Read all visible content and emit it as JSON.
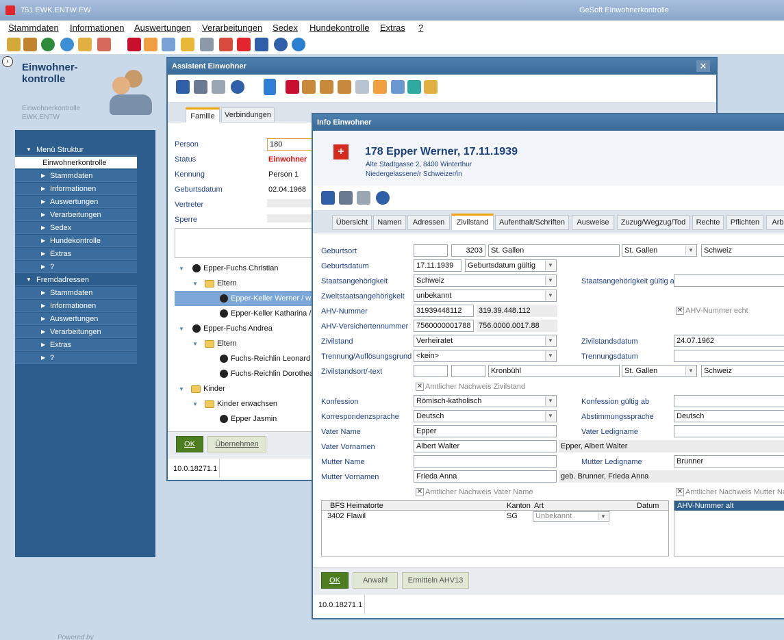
{
  "app": {
    "title": "751  EWK.ENTW  EW",
    "center_title": "GeSoft Einwohnerkontrolle"
  },
  "menu": [
    "Stammdaten",
    "Informationen",
    "Auswertungen",
    "Verarbeitungen",
    "Sedex",
    "Hundekontrolle",
    "Extras",
    "?"
  ],
  "left": {
    "title_line1": "Einwohner-",
    "title_line2": "kontrolle",
    "sub1": "Einwohnerkontrolle",
    "sub2": "EWK.ENTW",
    "powered": "Powered by",
    "nav": [
      {
        "label": "Menü Struktur",
        "kind": "sec",
        "arrow": "▼"
      },
      {
        "label": "Einwohnerkontrolle",
        "kind": "sel",
        "arrow": ""
      },
      {
        "label": "Stammdaten",
        "kind": "item",
        "arrow": "▶"
      },
      {
        "label": "Informationen",
        "kind": "item",
        "arrow": "▶"
      },
      {
        "label": "Auswertungen",
        "kind": "item",
        "arrow": "▶"
      },
      {
        "label": "Verarbeitungen",
        "kind": "item",
        "arrow": "▶"
      },
      {
        "label": "Sedex",
        "kind": "item",
        "arrow": "▶"
      },
      {
        "label": "Hundekontrolle",
        "kind": "item",
        "arrow": "▶"
      },
      {
        "label": "Extras",
        "kind": "item",
        "arrow": "▶"
      },
      {
        "label": "?",
        "kind": "item",
        "arrow": "▶"
      },
      {
        "label": "Fremdadressen",
        "kind": "sec",
        "arrow": "▼"
      },
      {
        "label": "Stammdaten",
        "kind": "item",
        "arrow": "▶"
      },
      {
        "label": "Informationen",
        "kind": "item",
        "arrow": "▶"
      },
      {
        "label": "Auswertungen",
        "kind": "item",
        "arrow": "▶"
      },
      {
        "label": "Verarbeitungen",
        "kind": "item",
        "arrow": "▶"
      },
      {
        "label": "Extras",
        "kind": "item",
        "arrow": "▶"
      },
      {
        "label": "?",
        "kind": "item",
        "arrow": "▶"
      }
    ]
  },
  "assist": {
    "title": "Assistent Einwohner",
    "tabs": [
      "Familie",
      "Verbindungen"
    ],
    "person_label": "Person",
    "person": "180",
    "status_label": "Status",
    "status": "Einwohner",
    "kennung_label": "Kennung",
    "kennung": "Person 1",
    "geb_label": "Geburtsdatum",
    "geb": "02.04.1968",
    "vertreter_label": "Vertreter",
    "sperre_label": "Sperre",
    "tree": [
      "Epper-Fuchs Christian",
      "Eltern",
      "Epper-Keller Werner / w",
      "Epper-Keller Katharina / v",
      "Epper-Fuchs Andrea",
      "Eltern",
      "Fuchs-Reichlin Leonard /",
      "Fuchs-Reichlin Dorothea",
      "Kinder",
      "Kinder erwachsen",
      "Epper Jasmin"
    ],
    "ok": "OK",
    "uebernehmen": "Übernehmen",
    "version": "10.0.18271.1"
  },
  "info": {
    "title": "Info Einwohner",
    "name": "178 Epper Werner, 17.11.1939",
    "addr": "Alte Stadtgasse 2, 8400 Winterthur",
    "status": "Niedergelassene/r Schweizer/in",
    "tabs": [
      "Übersicht",
      "Namen",
      "Adressen",
      "Zivilstand",
      "Aufenthalt/Schriften",
      "Ausweise",
      "Zuzug/Wegzug/Tod",
      "Rechte",
      "Pflichten",
      "Arbe"
    ],
    "f": {
      "geburtsort_l": "Geburtsort",
      "geburtsort_bfs": "3203",
      "geburtsort_ort": "St. Gallen",
      "geburtsort_kt": "St. Gallen",
      "geburtsort_land": "Schweiz",
      "geburtsdatum_l": "Geburtsdatum",
      "geburtsdatum": "17.11.1939",
      "geburtsdatum_st": "Geburtsdatum gültig",
      "staat_l": "Staatsangehörigkeit",
      "staat": "Schweiz",
      "staat_gueltig_l": "Staatsangehörigkeit gültig ab",
      "zweit_l": "Zweitstaatsangehörigkeit",
      "zweit": "unbekannt",
      "ahv_l": "AHV-Nummer",
      "ahv": "31939448112",
      "ahv_fmt": "319.39.448.112",
      "ahv_echt": "AHV-Nummer echt",
      "ahvv_l": "AHV-Versichertennummer",
      "ahvv": "7560000001788",
      "ahvv_fmt": "756.0000.0017.88",
      "ziv_l": "Zivilstand",
      "ziv": "Verheiratet",
      "zivdat_l": "Zivilstandsdatum",
      "zivdat": "24.07.1962",
      "trenn_l": "Trennung/Auflösungsgrund",
      "trenn": "<kein>",
      "trenndat_l": "Trennungsdatum",
      "zivort_l": "Zivilstandsort/-text",
      "zivort": "Kronbühl",
      "zivort_kt": "St. Gallen",
      "zivort_land": "Schweiz",
      "amtl_ziv": "Amtlicher Nachweis Zivilstand",
      "konf_l": "Konfession",
      "konf": "Römisch-katholisch",
      "konf_gueltig_l": "Konfession gültig ab",
      "korr_l": "Korrespondenzsprache",
      "korr": "Deutsch",
      "abst_l": "Abstimmungssprache",
      "abst": "Deutsch",
      "vname_l": "Vater Name",
      "vname": "Epper",
      "vledig_l": "Vater Ledigname",
      "vvor_l": "Vater Vornamen",
      "vvor": "Albert Walter",
      "vvor_full": "Epper, Albert Walter",
      "mname_l": "Mutter Name",
      "mledig_l": "Mutter Ledigname",
      "mledig": "Brunner",
      "mvor_l": "Mutter Vornamen",
      "mvor": "Frieda Anna",
      "mvor_full": "geb. Brunner, Frieda Anna",
      "amtl_v": "Amtlicher Nachweis Vater Name",
      "amtl_m": "Amtlicher Nachweis Mutter Na"
    },
    "table": {
      "headers": [
        "BFS",
        "Heimatorte",
        "Kanton",
        "Art",
        "Datum"
      ],
      "row": [
        "3402",
        "Flawil",
        "SG",
        "Unbekannt",
        ""
      ],
      "right_header": "AHV-Nummer alt"
    },
    "ok": "OK",
    "anwahl": "Anwahl",
    "ermitteln": "Ermitteln AHV13",
    "version": "10.0.18271.1"
  }
}
